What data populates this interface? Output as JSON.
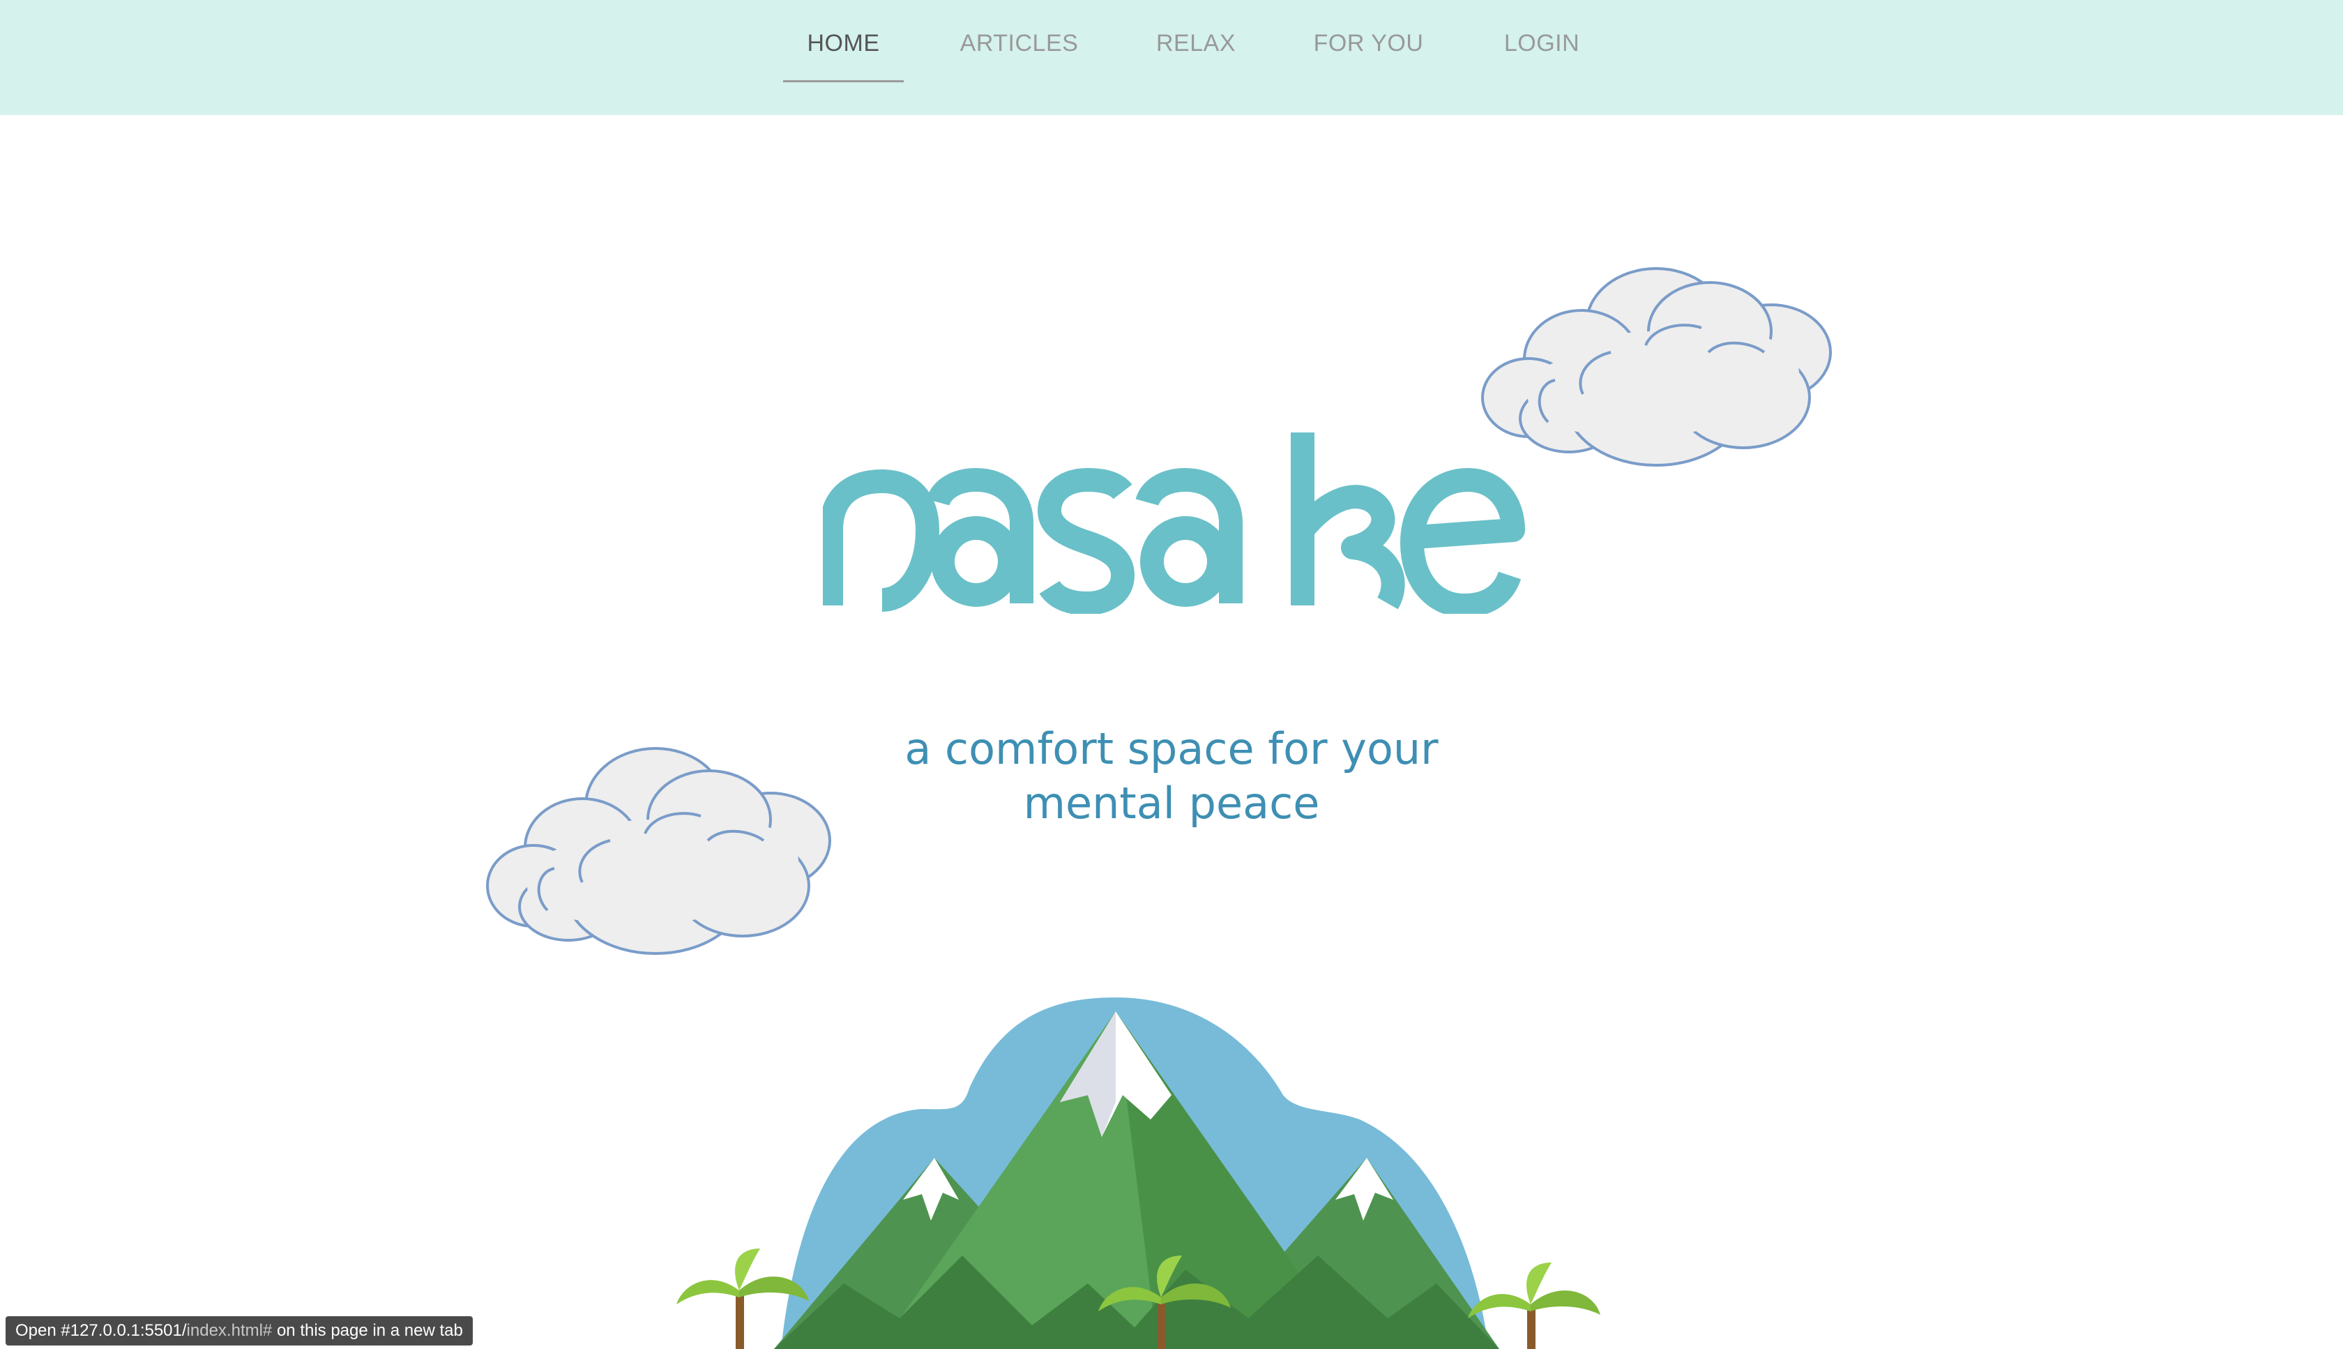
{
  "nav": {
    "items": [
      {
        "label": "HOME",
        "active": true
      },
      {
        "label": "ARTICLES",
        "active": false
      },
      {
        "label": "RELAX",
        "active": false
      },
      {
        "label": "FOR YOU",
        "active": false
      },
      {
        "label": "LOGIN",
        "active": false
      }
    ]
  },
  "hero": {
    "logo_text": "nasake",
    "tagline_line1": "a comfort space for your",
    "tagline_line2": "mental peace",
    "decorations": [
      "cloud-illustration",
      "cloud-illustration",
      "mountain-landscape-illustration"
    ]
  },
  "status_bar": {
    "prefix": "Open #127.0.0.1:5501/",
    "path": "index.html#",
    "suffix": " on this page in a new tab"
  },
  "colors": {
    "nav_background": "#d5f2ed",
    "nav_active": "#555555",
    "nav_inactive": "#999999",
    "logo": "#6ac0c8",
    "tagline": "#3e8fb3",
    "cloud_fill": "#eeeeee",
    "cloud_stroke": "#7a9cc9",
    "sky": "#78bbd9"
  }
}
